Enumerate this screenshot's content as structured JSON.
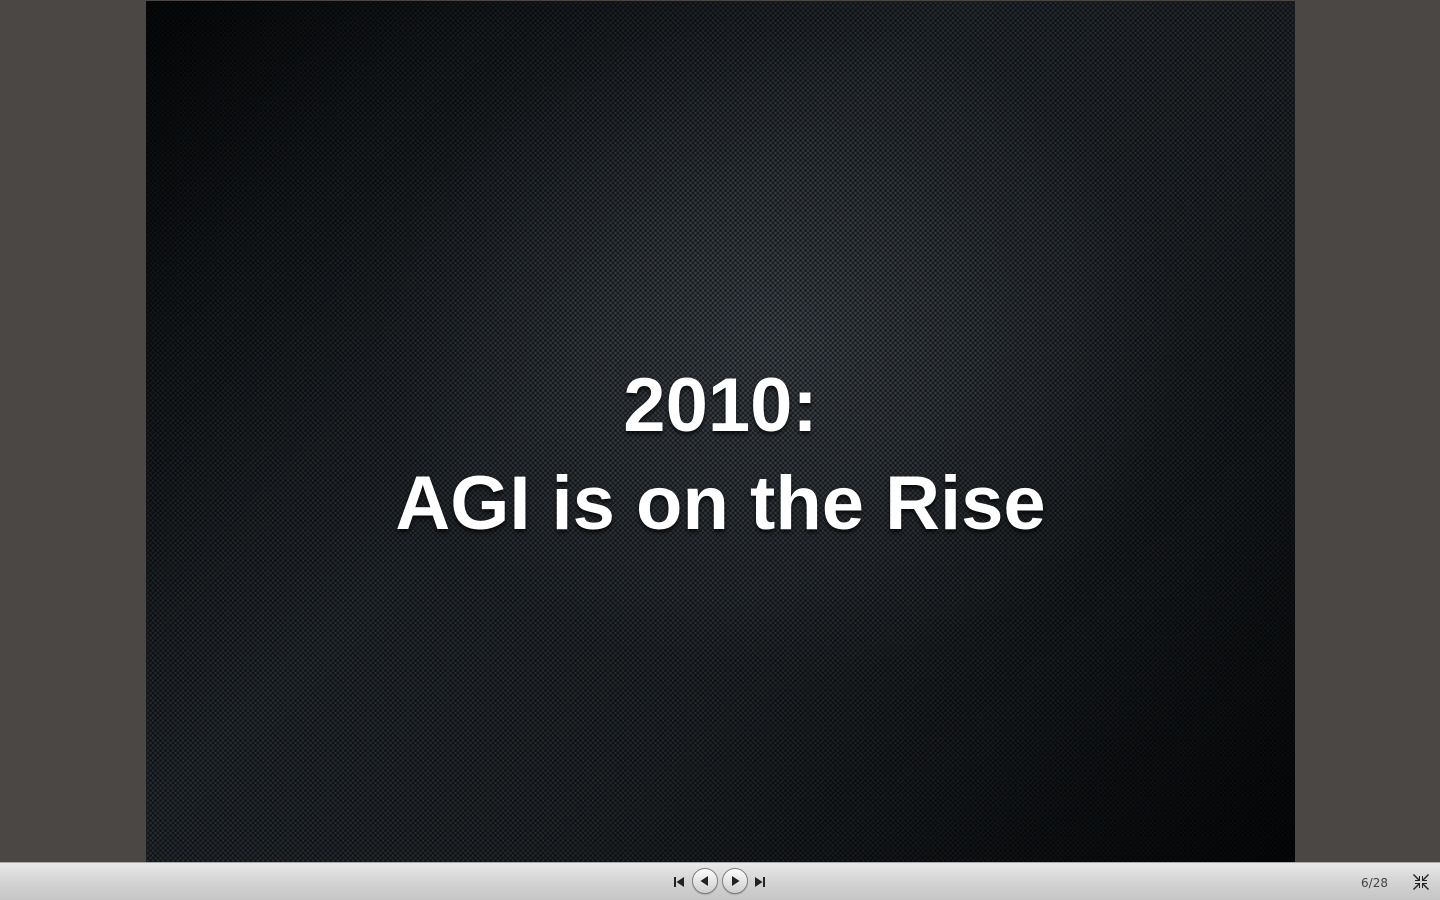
{
  "slide": {
    "line1": "2010:",
    "line2": "AGI is on the Rise"
  },
  "toolbar": {
    "first_icon": "skip-to-first-icon",
    "prev_icon": "previous-slide-icon",
    "next_icon": "next-slide-icon",
    "last_icon": "skip-to-last-icon",
    "exit_icon": "exit-fullscreen-icon",
    "page_counter": "6/28"
  },
  "colors": {
    "backdrop": "#4a4744",
    "slide_text": "#ffffff",
    "toolbar": "#d4d4d4"
  }
}
